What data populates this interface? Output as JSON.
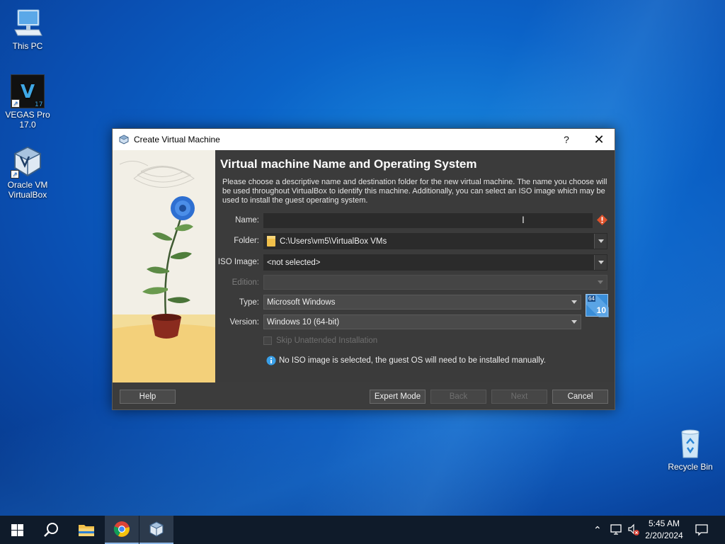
{
  "desktop": {
    "icons": [
      {
        "label": "This PC"
      },
      {
        "label_line1": "VEGAS Pro",
        "label_line2": "17.0",
        "badge": "17"
      },
      {
        "label_line1": "Oracle VM",
        "label_line2": "VirtualBox"
      },
      {
        "label": "Recycle Bin"
      }
    ]
  },
  "dialog": {
    "title": "Create Virtual Machine",
    "help_glyph": "?",
    "close_glyph": "✕",
    "heading": "Virtual machine Name and Operating System",
    "description": "Please choose a descriptive name and destination folder for the new virtual machine. The name you choose will be used throughout VirtualBox to identify this machine. Additionally, you can select an ISO image which may be used to install the guest operating system.",
    "fields": {
      "name_label": "Name:",
      "name_value": "",
      "folder_label": "Folder:",
      "folder_value": "C:\\Users\\vm5\\VirtualBox VMs",
      "iso_label": "ISO Image:",
      "iso_value": "<not selected>",
      "edition_label": "Edition:",
      "edition_value": "",
      "type_label": "Type:",
      "type_value": "Microsoft Windows",
      "version_label": "Version:",
      "version_value": "Windows 10 (64-bit)",
      "os_badge_top": "64",
      "os_badge_bottom": "10"
    },
    "skip_unattended_label": "Skip Unattended Installation",
    "skip_unattended_checked": false,
    "info_message": "No ISO image is selected, the guest OS will need to be installed manually.",
    "buttons": {
      "help": "Help",
      "expert_mode": "Expert Mode",
      "back": "Back",
      "next": "Next",
      "cancel": "Cancel"
    }
  },
  "taskbar": {
    "time": "5:45 AM",
    "date": "2/20/2024"
  },
  "colors": {
    "dialog_bg": "#3b3b3b",
    "warning": "#e0522b",
    "info": "#3aa0e8"
  }
}
